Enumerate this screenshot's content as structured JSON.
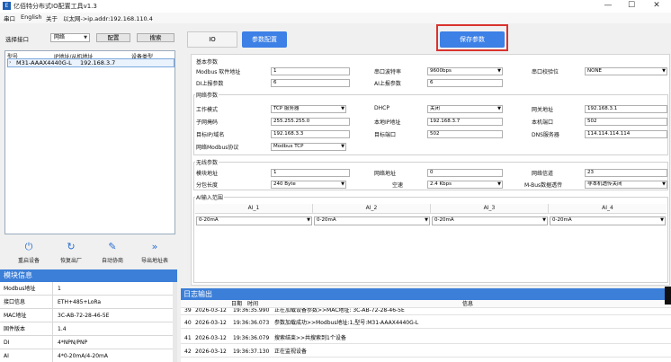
{
  "window": {
    "title": "亿佰特分布式IO配置工具v1.3",
    "icon_label": "E",
    "minimize": "—",
    "maximize": "☐",
    "close": "✕"
  },
  "menu": {
    "items": [
      "串口",
      "English",
      "关于"
    ],
    "connection": "以太网->ip.addr:192.168.110.4"
  },
  "left": {
    "select_port_label": "选择接口",
    "port_value": "网络",
    "config_button": "配置",
    "search_button": "搜索",
    "list_headers": [
      "型号",
      "IP地址/从机地址",
      "设备类型"
    ],
    "devices": [
      {
        "model": "M31-AAAX4440G-L",
        "ip": "192.168.3.7",
        "type": ""
      }
    ],
    "tools": [
      {
        "label": "重启设备",
        "icon": "power-icon"
      },
      {
        "label": "恢复出厂",
        "icon": "refresh-icon"
      },
      {
        "label": "自动协商",
        "icon": "edit-icon"
      },
      {
        "label": "导出地址表",
        "icon": "double-chevron-icon"
      }
    ],
    "module_info_title": "模块信息",
    "module_info": [
      {
        "key": "Modbus地址",
        "value": "1"
      },
      {
        "key": "接口信息",
        "value": "ETH+485+LoRa"
      },
      {
        "key": "MAC地址",
        "value": "3C-AB-72-28-46-5E"
      },
      {
        "key": "固件版本",
        "value": "1.4"
      },
      {
        "key": "DI",
        "value": "4*NPN/PNP"
      },
      {
        "key": "AI",
        "value": "4*0-20mA/4-20mA"
      }
    ]
  },
  "toolbar": {
    "io_tab": "IO",
    "param_config_button": "参数配置",
    "save_button": "保存参数"
  },
  "basic": {
    "title": "基本参数",
    "fields": [
      {
        "label": "Modbus 软件地址",
        "value": "1",
        "type": "input"
      },
      {
        "label": "串口波特率",
        "value": "9600bps",
        "type": "select"
      },
      {
        "label": "串口校验位",
        "value": "NONE",
        "type": "select"
      },
      {
        "label": "DI上报参数",
        "value": "6",
        "type": "input"
      },
      {
        "label": "AI上报参数",
        "value": "6",
        "type": "input"
      }
    ]
  },
  "network": {
    "title": "网络参数",
    "work_mode_label": "工作模式",
    "work_mode": "TCP 服务器",
    "dhcp_label": "DHCP",
    "dhcp": "关闭",
    "gateway_label": "网关地址",
    "gateway": "192.168.3.1",
    "subnet_label": "子网掩码",
    "subnet": "255.255.255.0",
    "local_ip_label": "本地IP地址",
    "local_ip": "192.168.3.7",
    "local_port_label": "本机端口",
    "local_port": "502",
    "target_ip_label": "目标IP/域名",
    "target_ip": "192.168.3.3",
    "target_port_label": "目标端口",
    "target_port": "502",
    "dns_label": "DNS服务器",
    "dns": "114.114.114.114",
    "protocol_label": "网络Modbus协议",
    "protocol": "Modbus TCP"
  },
  "wireless": {
    "title": "无线参数",
    "module_addr_label": "模块地址",
    "module_addr": "1",
    "net_addr_label": "网络地址",
    "net_addr": "0",
    "channel_label": "网络信道",
    "channel": "23",
    "packet_label": "分包长度",
    "packet": "240 Byte",
    "air_rate_label": "空速",
    "air_rate": "2.4 Kbps",
    "modbus_forward_label": "M-Bus数据透传",
    "modbus_forward": "非本机透传关闭"
  },
  "ai_range": {
    "title": "AI输入范围",
    "columns": [
      "AI_1",
      "AI_2",
      "AI_3",
      "AI_4"
    ],
    "values": [
      "0-20mA",
      "0-20mA",
      "0-20mA",
      "0-20mA"
    ]
  },
  "log": {
    "title": "日志输出",
    "headers": [
      "日期",
      "时间",
      "信息"
    ],
    "rows": [
      {
        "n": "39",
        "date": "2026-03-12",
        "time": "19:36:35.990",
        "msg": "正在加载设备参数>>MAC地址: 3C-AB-72-28-46-5E"
      },
      {
        "n": "40",
        "date": "2026-03-12",
        "time": "19:36:36.073",
        "msg": "参数加载成功>>Modbus地址:1,型号:M31-AAAX4440G-L"
      },
      {
        "n": "41",
        "date": "2026-03-12",
        "time": "19:36:36.079",
        "msg": "搜索结束>>共搜索到1个设备"
      },
      {
        "n": "42",
        "date": "2026-03-12",
        "time": "19:36:37.130",
        "msg": "正在监视设备"
      }
    ]
  },
  "colors": {
    "accent": "#3d80e6",
    "header_blue": "#3c7fd8",
    "highlight_red": "#d9332e"
  }
}
